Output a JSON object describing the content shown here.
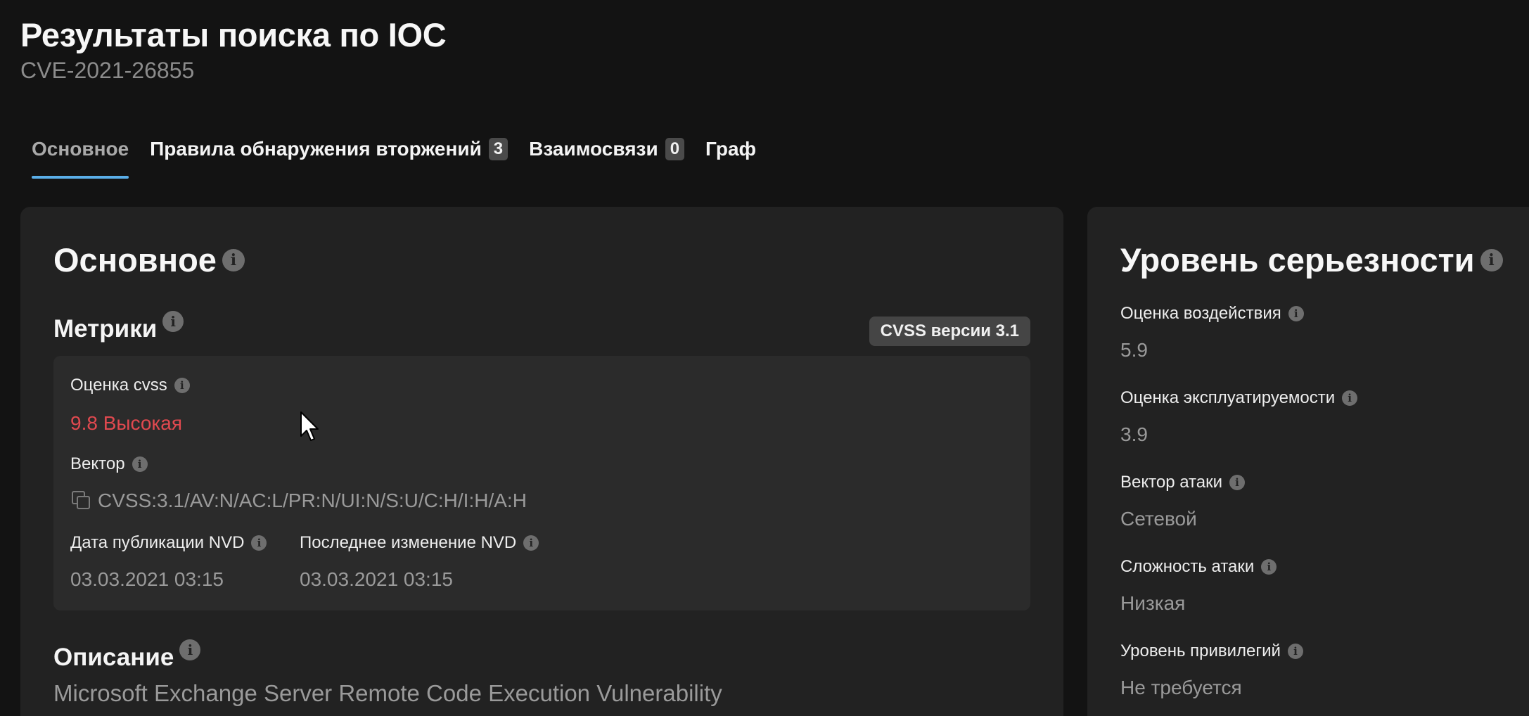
{
  "header": {
    "title": "Результаты поиска по IOC",
    "subtitle": "CVE-2021-26855"
  },
  "tabs": [
    {
      "label": "Основное",
      "active": true
    },
    {
      "label": "Правила обнаружения вторжений",
      "count": "3"
    },
    {
      "label": "Взаимосвязи",
      "count": "0"
    },
    {
      "label": "Граф"
    }
  ],
  "main": {
    "heading": "Основное",
    "metrics": {
      "heading": "Метрики",
      "badge": "CVSS версии 3.1",
      "cvss_label": "Оценка cvss",
      "cvss_value": "9.8 Высокая",
      "vector_label": "Вектор",
      "vector_value": "CVSS:3.1/AV:N/AC:L/PR:N/UI:N/S:U/C:H/I:H/A:H",
      "published_label": "Дата публикации NVD",
      "published_value": "03.03.2021 03:15",
      "modified_label": "Последнее изменение NVD",
      "modified_value": "03.03.2021 03:15"
    },
    "description": {
      "heading": "Описание",
      "text": "Microsoft Exchange Server Remote Code Execution Vulnerability"
    }
  },
  "side": {
    "heading": "Уровень серьезности",
    "items": [
      {
        "label": "Оценка воздействия",
        "value": "5.9"
      },
      {
        "label": "Оценка эксплуатируемости",
        "value": "3.9"
      },
      {
        "label": "Вектор атаки",
        "value": "Сетевой"
      },
      {
        "label": "Сложность атаки",
        "value": "Низкая"
      },
      {
        "label": "Уровень привилегий",
        "value": "Не требуется"
      }
    ]
  },
  "colors": {
    "background": "#131313",
    "card": "#222222",
    "accent": "#5aaee8",
    "severity_high": "#e0494f"
  }
}
